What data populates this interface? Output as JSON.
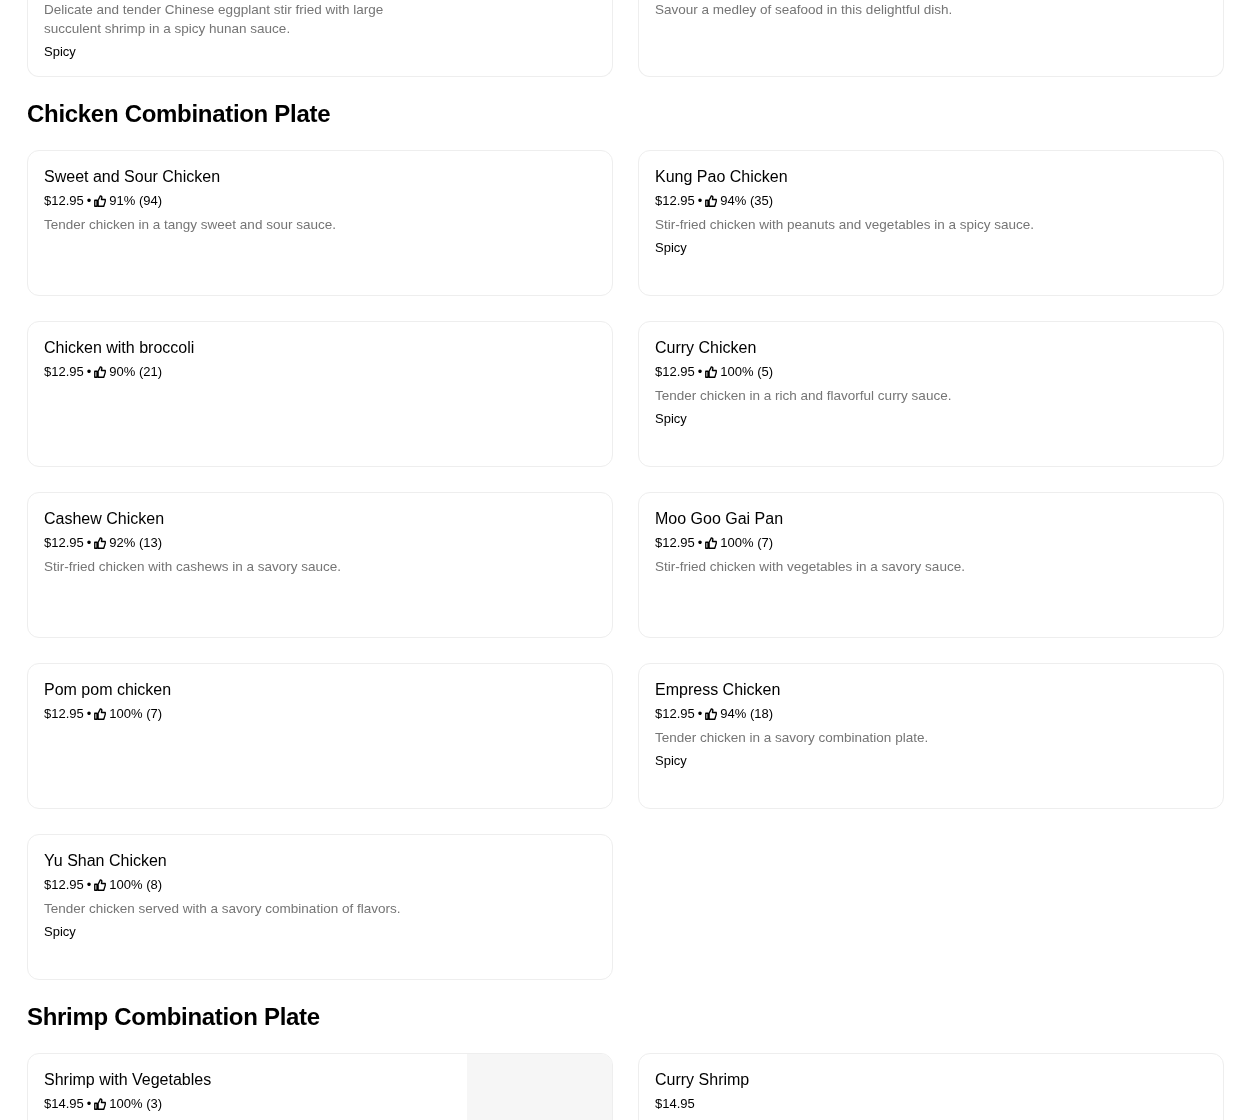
{
  "sections": [
    {
      "items": [
        {
          "description": "Delicate and tender Chinese eggplant stir fried with large succulent shrimp in a spicy hunan sauce.",
          "tag": "Spicy"
        },
        {
          "description": "Savour a medley of seafood in this delightful dish."
        }
      ]
    },
    {
      "title": "Chicken Combination Plate",
      "items": [
        {
          "name": "Sweet and Sour Chicken",
          "price": "$12.95",
          "separator": "•",
          "rating": "91% (94)",
          "description": "Tender chicken in a tangy sweet and sour sauce."
        },
        {
          "name": "Kung Pao Chicken",
          "price": "$12.95",
          "separator": "•",
          "rating": "94% (35)",
          "description": "Stir-fried chicken with peanuts and vegetables in a spicy sauce.",
          "tag": "Spicy"
        },
        {
          "name": "Chicken with broccoli",
          "price": "$12.95",
          "separator": "•",
          "rating": "90% (21)"
        },
        {
          "name": "Curry Chicken",
          "price": "$12.95",
          "separator": "•",
          "rating": "100% (5)",
          "description": "Tender chicken in a rich and flavorful curry sauce.",
          "tag": "Spicy"
        },
        {
          "name": "Cashew Chicken",
          "price": "$12.95",
          "separator": "•",
          "rating": "92% (13)",
          "description": "Stir-fried chicken with cashews in a savory sauce."
        },
        {
          "name": "Moo Goo Gai Pan",
          "price": "$12.95",
          "separator": "•",
          "rating": "100% (7)",
          "description": "Stir-fried chicken with vegetables in a savory sauce."
        },
        {
          "name": "Pom pom chicken",
          "price": "$12.95",
          "separator": "•",
          "rating": "100% (7)"
        },
        {
          "name": "Empress Chicken",
          "price": "$12.95",
          "separator": "•",
          "rating": "94% (18)",
          "description": "Tender chicken in a savory combination plate.",
          "tag": "Spicy"
        },
        {
          "name": "Yu Shan Chicken",
          "price": "$12.95",
          "separator": "•",
          "rating": "100% (8)",
          "description": "Tender chicken served with a savory combination of flavors.",
          "tag": "Spicy"
        }
      ]
    },
    {
      "title": "Shrimp Combination Plate",
      "items": [
        {
          "name": "Shrimp with Vegetables",
          "price": "$14.95",
          "separator": "•",
          "rating": "100% (3)"
        },
        {
          "name": "Curry Shrimp",
          "price": "$14.95"
        }
      ]
    }
  ]
}
